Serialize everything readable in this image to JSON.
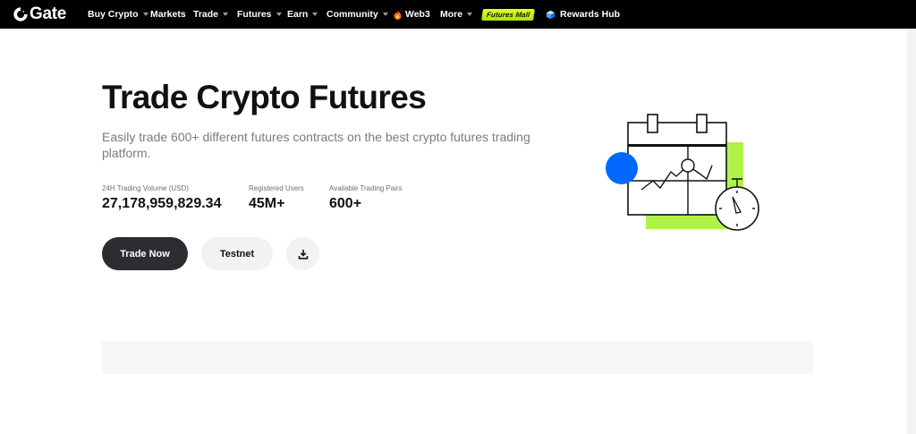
{
  "nav": {
    "logo_text": "Gate",
    "items": [
      {
        "label": "Buy Crypto",
        "caret": true
      },
      {
        "label": "Markets",
        "caret": false
      },
      {
        "label": "Trade",
        "caret": true
      },
      {
        "label": "Futures",
        "caret": true
      },
      {
        "label": "Earn",
        "caret": true
      },
      {
        "label": "Community",
        "caret": true
      },
      {
        "label": "Web3",
        "caret": false,
        "icon": "flame-icon"
      },
      {
        "label": "More",
        "caret": true
      }
    ],
    "badge_label": "Futures Mall",
    "rewards_label": "Rewards Hub"
  },
  "hero": {
    "title": "Trade Crypto Futures",
    "subtitle": "Easily trade 600+ different futures contracts on the best crypto futures trading platform.",
    "stats": [
      {
        "label": "24H Trading Volume (USD)",
        "value": "27,178,959,829.34"
      },
      {
        "label": "Registered Users",
        "value": "45M+"
      },
      {
        "label": "Available Trading Pairs",
        "value": "600+"
      }
    ],
    "buttons": {
      "primary": "Trade Now",
      "secondary": "Testnet",
      "download_icon": "download-icon"
    }
  },
  "colors": {
    "nav_bg": "#000000",
    "accent_blue": "#0068ff",
    "accent_green": "#b0f347",
    "primary_button": "#2b2d31",
    "secondary_button": "#f2f2f2"
  }
}
